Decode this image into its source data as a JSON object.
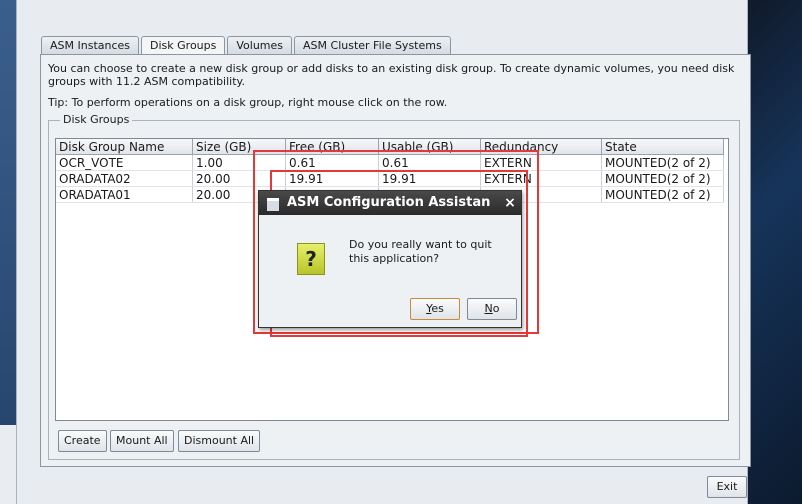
{
  "tabs": [
    "ASM Instances",
    "Disk Groups",
    "Volumes",
    "ASM Cluster File Systems"
  ],
  "description": "You can choose to create a new disk group or add disks to an existing disk group. To create dynamic volumes, you need disk groups with 11.2 ASM compatibility.",
  "tip": "Tip: To perform operations on a disk group, right mouse click on the row.",
  "group_title": "Disk Groups",
  "table": {
    "headers": [
      "Disk Group Name",
      "Size (GB)",
      "Free (GB)",
      "Usable (GB)",
      "Redundancy",
      "State"
    ],
    "rows": [
      [
        "OCR_VOTE",
        "1.00",
        "0.61",
        "0.61",
        "EXTERN",
        "MOUNTED(2 of 2)"
      ],
      [
        "ORADATA02",
        "20.00",
        "19.91",
        "19.91",
        "EXTERN",
        "MOUNTED(2 of 2)"
      ],
      [
        "ORADATA01",
        "20.00",
        "",
        "",
        "",
        "MOUNTED(2 of 2)"
      ]
    ]
  },
  "buttons": {
    "create": "Create",
    "mount_all": "Mount All",
    "dismount_all": "Dismount All",
    "exit": "Exit"
  },
  "dialog": {
    "title": "ASM Configuration Assistan",
    "close": "×",
    "icon": "question-icon",
    "icon_glyph": "?",
    "message": "Do you really want to quit this application?",
    "yes_mnemonic": "Y",
    "yes_rest": "es",
    "no_mnemonic": "N",
    "no_rest": "o"
  },
  "colors": {
    "highlight": "#e23a3a",
    "dialog_titlebar": "#2a2a2a",
    "question_icon": "#c8d43a"
  }
}
